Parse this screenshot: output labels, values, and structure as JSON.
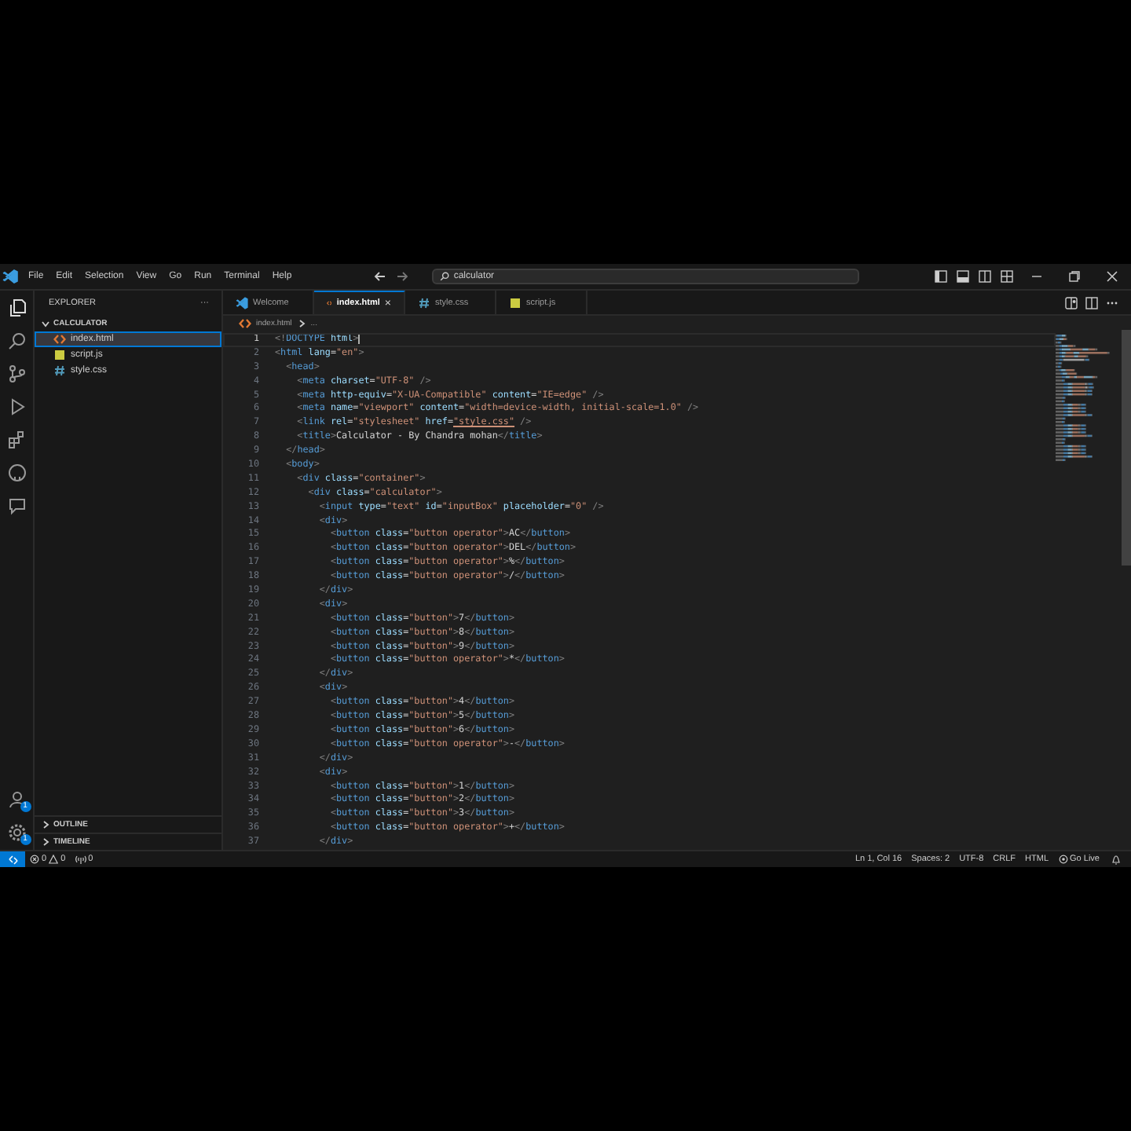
{
  "title_bar": {
    "menus": [
      "File",
      "Edit",
      "Selection",
      "View",
      "Go",
      "Run",
      "Terminal",
      "Help"
    ],
    "search": {
      "value": "calculator"
    }
  },
  "activity_bar": {
    "accounts_badge": "1",
    "settings_badge": "1"
  },
  "sidebar": {
    "title": "EXPLORER",
    "more": "···",
    "sections": [
      {
        "label": "CALCULATOR",
        "expanded": true,
        "files": [
          {
            "name": "index.html",
            "kind": "html",
            "selected": true
          },
          {
            "name": "script.js",
            "kind": "js",
            "selected": false
          },
          {
            "name": "style.css",
            "kind": "css",
            "selected": false
          }
        ]
      },
      {
        "label": "OUTLINE",
        "expanded": false
      },
      {
        "label": "TIMELINE",
        "expanded": false
      }
    ]
  },
  "tabs": [
    {
      "label": "Welcome",
      "kind": "welcome",
      "selected": false
    },
    {
      "label": "index.html",
      "kind": "html",
      "selected": true,
      "close": "×"
    },
    {
      "label": "style.css",
      "kind": "css",
      "selected": false
    },
    {
      "label": "script.js",
      "kind": "js",
      "selected": false
    }
  ],
  "breadcrumb": [
    "index.html",
    "..."
  ],
  "editor": {
    "lines": [
      {
        "n": "1",
        "current": true,
        "tokens": [
          {
            "kind": "punct",
            "text": "<!"
          },
          {
            "kind": "tag",
            "text": "DOCTYPE"
          },
          {
            "kind": "attr",
            "text": " html"
          },
          {
            "kind": "punct",
            "text": ">"
          }
        ]
      },
      {
        "n": "2",
        "current": false,
        "tokens": [
          {
            "kind": "punct",
            "text": "<"
          },
          {
            "kind": "tag",
            "text": "html"
          },
          {
            "kind": "attr",
            "text": " lang"
          },
          {
            "kind": "text",
            "text": "="
          },
          {
            "kind": "string",
            "text": "\"en\""
          },
          {
            "kind": "punct",
            "text": ">"
          }
        ]
      },
      {
        "n": "3",
        "current": false,
        "tokens": [
          {
            "kind": "punct",
            "text": "  <"
          },
          {
            "kind": "tag",
            "text": "head"
          },
          {
            "kind": "punct",
            "text": ">"
          }
        ]
      },
      {
        "n": "4",
        "current": false,
        "tokens": [
          {
            "kind": "punct",
            "text": "    <"
          },
          {
            "kind": "tag",
            "text": "meta"
          },
          {
            "kind": "attr",
            "text": " charset"
          },
          {
            "kind": "text",
            "text": "="
          },
          {
            "kind": "string",
            "text": "\"UTF-8\""
          },
          {
            "kind": "punct",
            "text": " />"
          }
        ]
      },
      {
        "n": "5",
        "current": false,
        "tokens": [
          {
            "kind": "punct",
            "text": "    <"
          },
          {
            "kind": "tag",
            "text": "meta"
          },
          {
            "kind": "attr",
            "text": " http-equiv"
          },
          {
            "kind": "text",
            "text": "="
          },
          {
            "kind": "string",
            "text": "\"X-UA-Compatible\""
          },
          {
            "kind": "attr",
            "text": " content"
          },
          {
            "kind": "text",
            "text": "="
          },
          {
            "kind": "string",
            "text": "\"IE=edge\""
          },
          {
            "kind": "punct",
            "text": " />"
          }
        ]
      },
      {
        "n": "6",
        "current": false,
        "tokens": [
          {
            "kind": "punct",
            "text": "    <"
          },
          {
            "kind": "tag",
            "text": "meta"
          },
          {
            "kind": "attr",
            "text": " name"
          },
          {
            "kind": "text",
            "text": "="
          },
          {
            "kind": "string",
            "text": "\"viewport\""
          },
          {
            "kind": "attr",
            "text": " content"
          },
          {
            "kind": "text",
            "text": "="
          },
          {
            "kind": "string",
            "text": "\"width=device-width, initial-scale=1.0\""
          },
          {
            "kind": "punct",
            "text": " />"
          }
        ]
      },
      {
        "n": "7",
        "current": false,
        "tokens": [
          {
            "kind": "punct",
            "text": "    <"
          },
          {
            "kind": "tag",
            "text": "link"
          },
          {
            "kind": "attr",
            "text": " rel"
          },
          {
            "kind": "text",
            "text": "="
          },
          {
            "kind": "string",
            "text": "\"stylesheet\""
          },
          {
            "kind": "attr",
            "text": " href"
          },
          {
            "kind": "text",
            "text": "="
          },
          {
            "kind": "link",
            "text": "\"style.css\""
          },
          {
            "kind": "punct",
            "text": " />"
          }
        ]
      },
      {
        "n": "8",
        "current": false,
        "tokens": [
          {
            "kind": "punct",
            "text": "    <"
          },
          {
            "kind": "tag",
            "text": "title"
          },
          {
            "kind": "punct",
            "text": ">"
          },
          {
            "kind": "text",
            "text": "Calculator - By Chandra mohan"
          },
          {
            "kind": "punct",
            "text": "</"
          },
          {
            "kind": "tag",
            "text": "title"
          },
          {
            "kind": "punct",
            "text": ">"
          }
        ]
      },
      {
        "n": "9",
        "current": false,
        "tokens": [
          {
            "kind": "punct",
            "text": "  </"
          },
          {
            "kind": "tag",
            "text": "head"
          },
          {
            "kind": "punct",
            "text": ">"
          }
        ]
      },
      {
        "n": "10",
        "current": false,
        "tokens": [
          {
            "kind": "punct",
            "text": "  <"
          },
          {
            "kind": "tag",
            "text": "body"
          },
          {
            "kind": "punct",
            "text": ">"
          }
        ]
      },
      {
        "n": "11",
        "current": false,
        "tokens": [
          {
            "kind": "punct",
            "text": "    <"
          },
          {
            "kind": "tag",
            "text": "div"
          },
          {
            "kind": "attr",
            "text": " class"
          },
          {
            "kind": "text",
            "text": "="
          },
          {
            "kind": "string",
            "text": "\"container\""
          },
          {
            "kind": "punct",
            "text": ">"
          }
        ]
      },
      {
        "n": "12",
        "current": false,
        "tokens": [
          {
            "kind": "punct",
            "text": "      <"
          },
          {
            "kind": "tag",
            "text": "div"
          },
          {
            "kind": "attr",
            "text": " class"
          },
          {
            "kind": "text",
            "text": "="
          },
          {
            "kind": "string",
            "text": "\"calculator\""
          },
          {
            "kind": "punct",
            "text": ">"
          }
        ]
      },
      {
        "n": "13",
        "current": false,
        "tokens": [
          {
            "kind": "punct",
            "text": "        <"
          },
          {
            "kind": "tag",
            "text": "input"
          },
          {
            "kind": "attr",
            "text": " type"
          },
          {
            "kind": "text",
            "text": "="
          },
          {
            "kind": "string",
            "text": "\"text\""
          },
          {
            "kind": "attr",
            "text": " id"
          },
          {
            "kind": "text",
            "text": "="
          },
          {
            "kind": "string",
            "text": "\"inputBox\""
          },
          {
            "kind": "attr",
            "text": " placeholder"
          },
          {
            "kind": "text",
            "text": "="
          },
          {
            "kind": "string",
            "text": "\"0\""
          },
          {
            "kind": "punct",
            "text": " />"
          }
        ]
      },
      {
        "n": "14",
        "current": false,
        "tokens": [
          {
            "kind": "punct",
            "text": "        <"
          },
          {
            "kind": "tag",
            "text": "div"
          },
          {
            "kind": "punct",
            "text": ">"
          }
        ]
      },
      {
        "n": "15",
        "current": false,
        "tokens": [
          {
            "kind": "punct",
            "text": "          <"
          },
          {
            "kind": "tag",
            "text": "button"
          },
          {
            "kind": "attr",
            "text": " class"
          },
          {
            "kind": "text",
            "text": "="
          },
          {
            "kind": "string",
            "text": "\"button operator\""
          },
          {
            "kind": "punct",
            "text": ">"
          },
          {
            "kind": "text",
            "text": "AC"
          },
          {
            "kind": "punct",
            "text": "</"
          },
          {
            "kind": "tag",
            "text": "button"
          },
          {
            "kind": "punct",
            "text": ">"
          }
        ]
      },
      {
        "n": "16",
        "current": false,
        "tokens": [
          {
            "kind": "punct",
            "text": "          <"
          },
          {
            "kind": "tag",
            "text": "button"
          },
          {
            "kind": "attr",
            "text": " class"
          },
          {
            "kind": "text",
            "text": "="
          },
          {
            "kind": "string",
            "text": "\"button operator\""
          },
          {
            "kind": "punct",
            "text": ">"
          },
          {
            "kind": "text",
            "text": "DEL"
          },
          {
            "kind": "punct",
            "text": "</"
          },
          {
            "kind": "tag",
            "text": "button"
          },
          {
            "kind": "punct",
            "text": ">"
          }
        ]
      },
      {
        "n": "17",
        "current": false,
        "tokens": [
          {
            "kind": "punct",
            "text": "          <"
          },
          {
            "kind": "tag",
            "text": "button"
          },
          {
            "kind": "attr",
            "text": " class"
          },
          {
            "kind": "text",
            "text": "="
          },
          {
            "kind": "string",
            "text": "\"button operator\""
          },
          {
            "kind": "punct",
            "text": ">"
          },
          {
            "kind": "text",
            "text": "%"
          },
          {
            "kind": "punct",
            "text": "</"
          },
          {
            "kind": "tag",
            "text": "button"
          },
          {
            "kind": "punct",
            "text": ">"
          }
        ]
      },
      {
        "n": "18",
        "current": false,
        "tokens": [
          {
            "kind": "punct",
            "text": "          <"
          },
          {
            "kind": "tag",
            "text": "button"
          },
          {
            "kind": "attr",
            "text": " class"
          },
          {
            "kind": "text",
            "text": "="
          },
          {
            "kind": "string",
            "text": "\"button operator\""
          },
          {
            "kind": "punct",
            "text": ">"
          },
          {
            "kind": "text",
            "text": "/"
          },
          {
            "kind": "punct",
            "text": "</"
          },
          {
            "kind": "tag",
            "text": "button"
          },
          {
            "kind": "punct",
            "text": ">"
          }
        ]
      },
      {
        "n": "19",
        "current": false,
        "tokens": [
          {
            "kind": "punct",
            "text": "        </"
          },
          {
            "kind": "tag",
            "text": "div"
          },
          {
            "kind": "punct",
            "text": ">"
          }
        ]
      },
      {
        "n": "20",
        "current": false,
        "tokens": [
          {
            "kind": "punct",
            "text": "        <"
          },
          {
            "kind": "tag",
            "text": "div"
          },
          {
            "kind": "punct",
            "text": ">"
          }
        ]
      },
      {
        "n": "21",
        "current": false,
        "tokens": [
          {
            "kind": "punct",
            "text": "          <"
          },
          {
            "kind": "tag",
            "text": "button"
          },
          {
            "kind": "attr",
            "text": " class"
          },
          {
            "kind": "text",
            "text": "="
          },
          {
            "kind": "string",
            "text": "\"button\""
          },
          {
            "kind": "punct",
            "text": ">"
          },
          {
            "kind": "text",
            "text": "7"
          },
          {
            "kind": "punct",
            "text": "</"
          },
          {
            "kind": "tag",
            "text": "button"
          },
          {
            "kind": "punct",
            "text": ">"
          }
        ]
      },
      {
        "n": "22",
        "current": false,
        "tokens": [
          {
            "kind": "punct",
            "text": "          <"
          },
          {
            "kind": "tag",
            "text": "button"
          },
          {
            "kind": "attr",
            "text": " class"
          },
          {
            "kind": "text",
            "text": "="
          },
          {
            "kind": "string",
            "text": "\"button\""
          },
          {
            "kind": "punct",
            "text": ">"
          },
          {
            "kind": "text",
            "text": "8"
          },
          {
            "kind": "punct",
            "text": "</"
          },
          {
            "kind": "tag",
            "text": "button"
          },
          {
            "kind": "punct",
            "text": ">"
          }
        ]
      },
      {
        "n": "23",
        "current": false,
        "tokens": [
          {
            "kind": "punct",
            "text": "          <"
          },
          {
            "kind": "tag",
            "text": "button"
          },
          {
            "kind": "attr",
            "text": " class"
          },
          {
            "kind": "text",
            "text": "="
          },
          {
            "kind": "string",
            "text": "\"button\""
          },
          {
            "kind": "punct",
            "text": ">"
          },
          {
            "kind": "text",
            "text": "9"
          },
          {
            "kind": "punct",
            "text": "</"
          },
          {
            "kind": "tag",
            "text": "button"
          },
          {
            "kind": "punct",
            "text": ">"
          }
        ]
      },
      {
        "n": "24",
        "current": false,
        "tokens": [
          {
            "kind": "punct",
            "text": "          <"
          },
          {
            "kind": "tag",
            "text": "button"
          },
          {
            "kind": "attr",
            "text": " class"
          },
          {
            "kind": "text",
            "text": "="
          },
          {
            "kind": "string",
            "text": "\"button operator\""
          },
          {
            "kind": "punct",
            "text": ">"
          },
          {
            "kind": "text",
            "text": "*"
          },
          {
            "kind": "punct",
            "text": "</"
          },
          {
            "kind": "tag",
            "text": "button"
          },
          {
            "kind": "punct",
            "text": ">"
          }
        ]
      },
      {
        "n": "25",
        "current": false,
        "tokens": [
          {
            "kind": "punct",
            "text": "        </"
          },
          {
            "kind": "tag",
            "text": "div"
          },
          {
            "kind": "punct",
            "text": ">"
          }
        ]
      },
      {
        "n": "26",
        "current": false,
        "tokens": [
          {
            "kind": "punct",
            "text": "        <"
          },
          {
            "kind": "tag",
            "text": "div"
          },
          {
            "kind": "punct",
            "text": ">"
          }
        ]
      },
      {
        "n": "27",
        "current": false,
        "tokens": [
          {
            "kind": "punct",
            "text": "          <"
          },
          {
            "kind": "tag",
            "text": "button"
          },
          {
            "kind": "attr",
            "text": " class"
          },
          {
            "kind": "text",
            "text": "="
          },
          {
            "kind": "string",
            "text": "\"button\""
          },
          {
            "kind": "punct",
            "text": ">"
          },
          {
            "kind": "text",
            "text": "4"
          },
          {
            "kind": "punct",
            "text": "</"
          },
          {
            "kind": "tag",
            "text": "button"
          },
          {
            "kind": "punct",
            "text": ">"
          }
        ]
      },
      {
        "n": "28",
        "current": false,
        "tokens": [
          {
            "kind": "punct",
            "text": "          <"
          },
          {
            "kind": "tag",
            "text": "button"
          },
          {
            "kind": "attr",
            "text": " class"
          },
          {
            "kind": "text",
            "text": "="
          },
          {
            "kind": "string",
            "text": "\"button\""
          },
          {
            "kind": "punct",
            "text": ">"
          },
          {
            "kind": "text",
            "text": "5"
          },
          {
            "kind": "punct",
            "text": "</"
          },
          {
            "kind": "tag",
            "text": "button"
          },
          {
            "kind": "punct",
            "text": ">"
          }
        ]
      },
      {
        "n": "29",
        "current": false,
        "tokens": [
          {
            "kind": "punct",
            "text": "          <"
          },
          {
            "kind": "tag",
            "text": "button"
          },
          {
            "kind": "attr",
            "text": " class"
          },
          {
            "kind": "text",
            "text": "="
          },
          {
            "kind": "string",
            "text": "\"button\""
          },
          {
            "kind": "punct",
            "text": ">"
          },
          {
            "kind": "text",
            "text": "6"
          },
          {
            "kind": "punct",
            "text": "</"
          },
          {
            "kind": "tag",
            "text": "button"
          },
          {
            "kind": "punct",
            "text": ">"
          }
        ]
      },
      {
        "n": "30",
        "current": false,
        "tokens": [
          {
            "kind": "punct",
            "text": "          <"
          },
          {
            "kind": "tag",
            "text": "button"
          },
          {
            "kind": "attr",
            "text": " class"
          },
          {
            "kind": "text",
            "text": "="
          },
          {
            "kind": "string",
            "text": "\"button operator\""
          },
          {
            "kind": "punct",
            "text": ">"
          },
          {
            "kind": "text",
            "text": "-"
          },
          {
            "kind": "punct",
            "text": "</"
          },
          {
            "kind": "tag",
            "text": "button"
          },
          {
            "kind": "punct",
            "text": ">"
          }
        ]
      },
      {
        "n": "31",
        "current": false,
        "tokens": [
          {
            "kind": "punct",
            "text": "        </"
          },
          {
            "kind": "tag",
            "text": "div"
          },
          {
            "kind": "punct",
            "text": ">"
          }
        ]
      },
      {
        "n": "32",
        "current": false,
        "tokens": [
          {
            "kind": "punct",
            "text": "        <"
          },
          {
            "kind": "tag",
            "text": "div"
          },
          {
            "kind": "punct",
            "text": ">"
          }
        ]
      },
      {
        "n": "33",
        "current": false,
        "tokens": [
          {
            "kind": "punct",
            "text": "          <"
          },
          {
            "kind": "tag",
            "text": "button"
          },
          {
            "kind": "attr",
            "text": " class"
          },
          {
            "kind": "text",
            "text": "="
          },
          {
            "kind": "string",
            "text": "\"button\""
          },
          {
            "kind": "punct",
            "text": ">"
          },
          {
            "kind": "text",
            "text": "1"
          },
          {
            "kind": "punct",
            "text": "</"
          },
          {
            "kind": "tag",
            "text": "button"
          },
          {
            "kind": "punct",
            "text": ">"
          }
        ]
      },
      {
        "n": "34",
        "current": false,
        "tokens": [
          {
            "kind": "punct",
            "text": "          <"
          },
          {
            "kind": "tag",
            "text": "button"
          },
          {
            "kind": "attr",
            "text": " class"
          },
          {
            "kind": "text",
            "text": "="
          },
          {
            "kind": "string",
            "text": "\"button\""
          },
          {
            "kind": "punct",
            "text": ">"
          },
          {
            "kind": "text",
            "text": "2"
          },
          {
            "kind": "punct",
            "text": "</"
          },
          {
            "kind": "tag",
            "text": "button"
          },
          {
            "kind": "punct",
            "text": ">"
          }
        ]
      },
      {
        "n": "35",
        "current": false,
        "tokens": [
          {
            "kind": "punct",
            "text": "          <"
          },
          {
            "kind": "tag",
            "text": "button"
          },
          {
            "kind": "attr",
            "text": " class"
          },
          {
            "kind": "text",
            "text": "="
          },
          {
            "kind": "string",
            "text": "\"button\""
          },
          {
            "kind": "punct",
            "text": ">"
          },
          {
            "kind": "text",
            "text": "3"
          },
          {
            "kind": "punct",
            "text": "</"
          },
          {
            "kind": "tag",
            "text": "button"
          },
          {
            "kind": "punct",
            "text": ">"
          }
        ]
      },
      {
        "n": "36",
        "current": false,
        "tokens": [
          {
            "kind": "punct",
            "text": "          <"
          },
          {
            "kind": "tag",
            "text": "button"
          },
          {
            "kind": "attr",
            "text": " class"
          },
          {
            "kind": "text",
            "text": "="
          },
          {
            "kind": "string",
            "text": "\"button operator\""
          },
          {
            "kind": "punct",
            "text": ">"
          },
          {
            "kind": "text",
            "text": "+"
          },
          {
            "kind": "punct",
            "text": "</"
          },
          {
            "kind": "tag",
            "text": "button"
          },
          {
            "kind": "punct",
            "text": ">"
          }
        ]
      },
      {
        "n": "37",
        "current": false,
        "tokens": [
          {
            "kind": "punct",
            "text": "        </"
          },
          {
            "kind": "tag",
            "text": "div"
          },
          {
            "kind": "punct",
            "text": ">"
          }
        ]
      }
    ]
  },
  "status_bar": {
    "errors": "0",
    "warnings": "0",
    "ports": "0",
    "items": [
      "Ln 1, Col 16",
      "Spaces: 2",
      "UTF-8",
      "CRLF",
      "HTML"
    ],
    "go_live": "Go Live"
  }
}
